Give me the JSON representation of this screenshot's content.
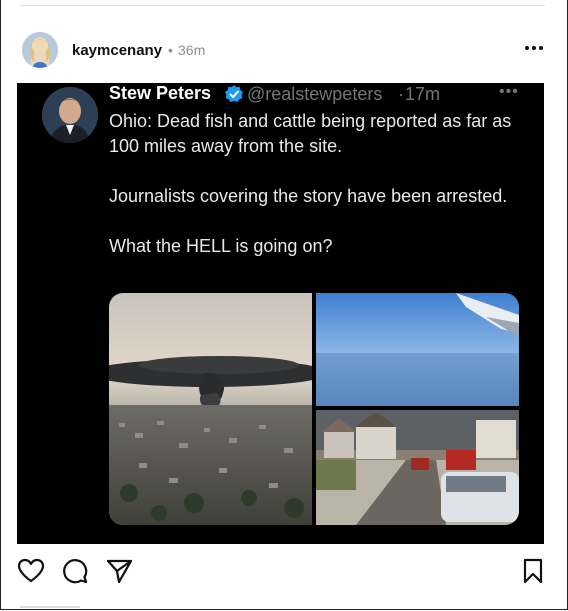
{
  "post": {
    "username": "kaymcenany",
    "separator": "•",
    "time": "36m",
    "avatar_icon": "profile-photo",
    "more_icon": "more-horizontal-icon"
  },
  "tweet": {
    "display_name": "Stew Peters",
    "handle": "@realstewpeters",
    "separator": "·",
    "time": "17m",
    "more": "•••",
    "verified_color": "#1d9bf0",
    "paragraphs": [
      "Ohio: Dead fish and cattle being reported as far as 100 miles away from the site.",
      "Journalists covering the story have been arrested.",
      "What the HELL is going on?"
    ],
    "media": [
      {
        "name": "aerial-smoke-cloud-photo"
      },
      {
        "name": "airplane-window-sky-photo"
      },
      {
        "name": "street-fire-trucks-photo"
      }
    ]
  },
  "actions": {
    "like_icon": "heart-icon",
    "comment_icon": "comment-icon",
    "share_icon": "send-icon",
    "save_icon": "bookmark-icon"
  },
  "colors": {
    "tweet_background": "#000000",
    "tweet_text": "#e7e9ea",
    "tweet_muted": "#71767b"
  }
}
